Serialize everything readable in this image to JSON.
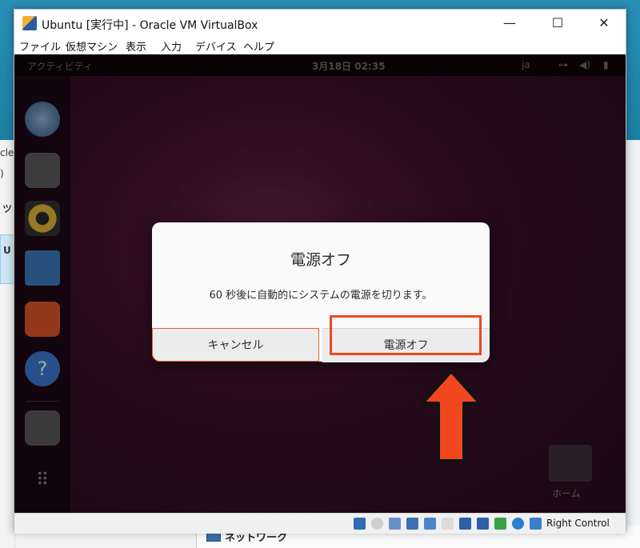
{
  "window": {
    "title": "Ubuntu [実行中] - Oracle VM VirtualBox",
    "menu": [
      "ファイル",
      "仮想マシン",
      "表示",
      "入力",
      "デバイス",
      "ヘルプ"
    ],
    "controls": {
      "minimize": "—",
      "maximize": "☐",
      "close": "✕"
    }
  },
  "guest": {
    "activities": "アクティビティ",
    "clock": "3月18日  02:35",
    "lang": "ja",
    "home_label": "ホーム"
  },
  "dialog": {
    "title": "電源オフ",
    "message": "60 秒後に自動的にシステムの電源を切ります。",
    "cancel_label": "キャンセル",
    "power_off_label": "電源オフ"
  },
  "statusbar": {
    "host_key": "Right Control"
  },
  "host": {
    "partial_texts": [
      "cle",
      ")",
      "ツ",
      "U"
    ],
    "network_label": "ネットワーク"
  },
  "colors": {
    "highlight": "#f0471e",
    "arrow": "#f0471e"
  }
}
